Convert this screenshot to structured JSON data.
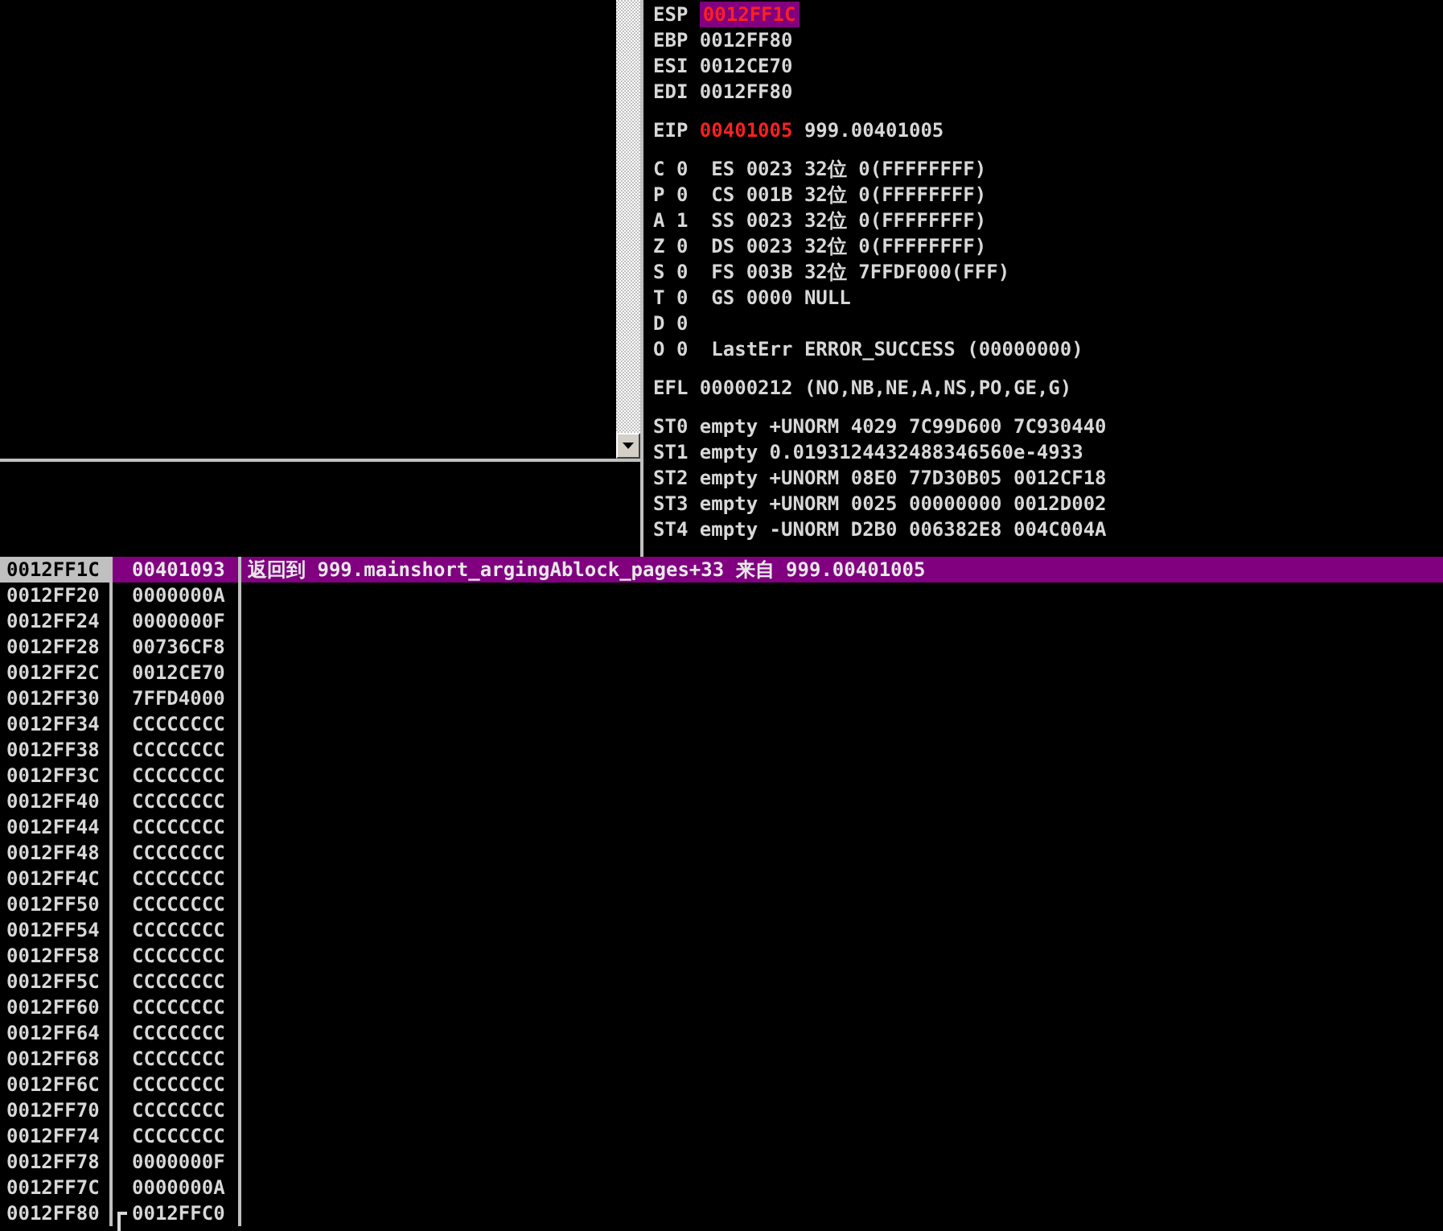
{
  "registers": [
    {
      "lines": [
        {
          "kind": "reg",
          "name": "ESP",
          "value": "0012FF1C",
          "changed": true,
          "selected": true
        },
        {
          "kind": "reg",
          "name": "EBP",
          "value": "0012FF80",
          "changed": false,
          "selected": false
        },
        {
          "kind": "reg",
          "name": "ESI",
          "value": "0012CE70",
          "changed": false,
          "selected": false
        },
        {
          "kind": "reg",
          "name": "EDI",
          "value": "0012FF80",
          "changed": false,
          "selected": false
        }
      ]
    },
    {
      "lines": [
        {
          "kind": "reg",
          "name": "EIP",
          "value": "00401005",
          "changed": true,
          "selected": false,
          "note": "999.00401005"
        }
      ]
    },
    {
      "lines": [
        {
          "kind": "flag",
          "flag": "C",
          "bit": "0",
          "detail": "ES 0023 32位 0(FFFFFFFF)"
        },
        {
          "kind": "flag",
          "flag": "P",
          "bit": "0",
          "detail": "CS 001B 32位 0(FFFFFFFF)"
        },
        {
          "kind": "flag",
          "flag": "A",
          "bit": "1",
          "detail": "SS 0023 32位 0(FFFFFFFF)"
        },
        {
          "kind": "flag",
          "flag": "Z",
          "bit": "0",
          "detail": "DS 0023 32位 0(FFFFFFFF)"
        },
        {
          "kind": "flag",
          "flag": "S",
          "bit": "0",
          "detail": "FS 003B 32位 7FFDF000(FFF)"
        },
        {
          "kind": "flag",
          "flag": "T",
          "bit": "0",
          "detail": "GS 0000 NULL"
        },
        {
          "kind": "flag",
          "flag": "D",
          "bit": "0"
        },
        {
          "kind": "flag",
          "flag": "O",
          "bit": "0",
          "detail": "LastErr ERROR_SUCCESS (00000000)"
        }
      ]
    },
    {
      "lines": [
        {
          "kind": "reg",
          "name": "EFL",
          "value": "00000212",
          "changed": false,
          "selected": false,
          "note": "(NO,NB,NE,A,NS,PO,GE,G)"
        }
      ]
    },
    {
      "lines": [
        {
          "kind": "fpu",
          "name": "ST0",
          "text": "empty +UNORM 4029 7C99D600 7C930440"
        },
        {
          "kind": "fpu",
          "name": "ST1",
          "text": "empty 0.0193124432488346560e-4933"
        },
        {
          "kind": "fpu",
          "name": "ST2",
          "text": "empty +UNORM 08E0 77D30B05 0012CF18"
        },
        {
          "kind": "fpu",
          "name": "ST3",
          "text": "empty +UNORM 0025 00000000 0012D002"
        },
        {
          "kind": "fpu",
          "name": "ST4",
          "text": "empty -UNORM D2B0 006382E8 004C004A"
        }
      ]
    }
  ],
  "stack": [
    {
      "address": "0012FF1C",
      "value": "00401093",
      "comment": "返回到 999.mainshort_argingAblock_pages+33 来自 999.00401005",
      "selected": true,
      "frame_start": false
    },
    {
      "address": "0012FF20",
      "value": "0000000A",
      "selected": false,
      "frame_start": false
    },
    {
      "address": "0012FF24",
      "value": "0000000F",
      "selected": false,
      "frame_start": false
    },
    {
      "address": "0012FF28",
      "value": "00736CF8",
      "selected": false,
      "frame_start": false
    },
    {
      "address": "0012FF2C",
      "value": "0012CE70",
      "selected": false,
      "frame_start": false
    },
    {
      "address": "0012FF30",
      "value": "7FFD4000",
      "selected": false,
      "frame_start": false
    },
    {
      "address": "0012FF34",
      "value": "CCCCCCCC",
      "selected": false,
      "frame_start": false
    },
    {
      "address": "0012FF38",
      "value": "CCCCCCCC",
      "selected": false,
      "frame_start": false
    },
    {
      "address": "0012FF3C",
      "value": "CCCCCCCC",
      "selected": false,
      "frame_start": false
    },
    {
      "address": "0012FF40",
      "value": "CCCCCCCC",
      "selected": false,
      "frame_start": false
    },
    {
      "address": "0012FF44",
      "value": "CCCCCCCC",
      "selected": false,
      "frame_start": false
    },
    {
      "address": "0012FF48",
      "value": "CCCCCCCC",
      "selected": false,
      "frame_start": false
    },
    {
      "address": "0012FF4C",
      "value": "CCCCCCCC",
      "selected": false,
      "frame_start": false
    },
    {
      "address": "0012FF50",
      "value": "CCCCCCCC",
      "selected": false,
      "frame_start": false
    },
    {
      "address": "0012FF54",
      "value": "CCCCCCCC",
      "selected": false,
      "frame_start": false
    },
    {
      "address": "0012FF58",
      "value": "CCCCCCCC",
      "selected": false,
      "frame_start": false
    },
    {
      "address": "0012FF5C",
      "value": "CCCCCCCC",
      "selected": false,
      "frame_start": false
    },
    {
      "address": "0012FF60",
      "value": "CCCCCCCC",
      "selected": false,
      "frame_start": false
    },
    {
      "address": "0012FF64",
      "value": "CCCCCCCC",
      "selected": false,
      "frame_start": false
    },
    {
      "address": "0012FF68",
      "value": "CCCCCCCC",
      "selected": false,
      "frame_start": false
    },
    {
      "address": "0012FF6C",
      "value": "CCCCCCCC",
      "selected": false,
      "frame_start": false
    },
    {
      "address": "0012FF70",
      "value": "CCCCCCCC",
      "selected": false,
      "frame_start": false
    },
    {
      "address": "0012FF74",
      "value": "CCCCCCCC",
      "selected": false,
      "frame_start": false
    },
    {
      "address": "0012FF78",
      "value": "0000000F",
      "selected": false,
      "frame_start": false
    },
    {
      "address": "0012FF7C",
      "value": "0000000A",
      "selected": false,
      "frame_start": false
    },
    {
      "address": "0012FF80",
      "value": "0012FFC0",
      "selected": false,
      "frame_start": true
    }
  ]
}
